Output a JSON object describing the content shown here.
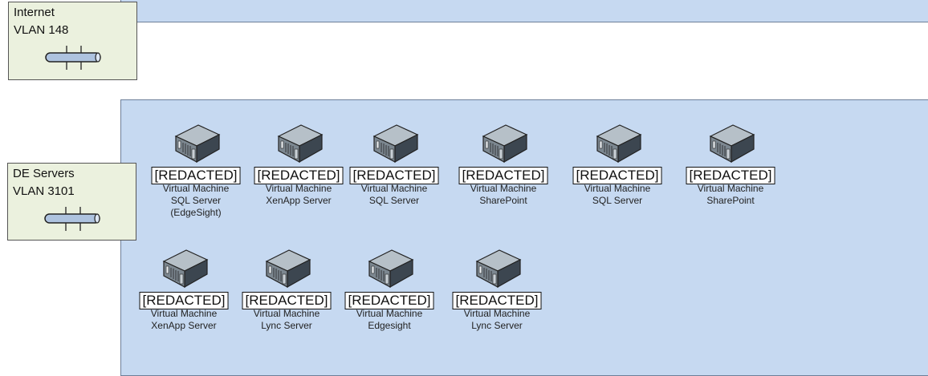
{
  "vlans": [
    {
      "name": "Internet",
      "vlan": "VLAN 148"
    },
    {
      "name": "DE Servers",
      "vlan": "VLAN 3101"
    }
  ],
  "servers_row1": [
    {
      "redacted": "[REDACTED]",
      "lines": [
        "Virtual Machine",
        "SQL Server",
        "(EdgeSight)"
      ]
    },
    {
      "redacted": "[REDACTED]",
      "lines": [
        "Virtual Machine",
        "XenApp Server"
      ]
    },
    {
      "redacted": "[REDACTED]",
      "lines": [
        "Virtual Machine",
        "SQL Server"
      ]
    },
    {
      "redacted": "[REDACTED]",
      "lines": [
        "Virtual Machine",
        "SharePoint"
      ]
    },
    {
      "redacted": "[REDACTED]",
      "lines": [
        "Virtual Machine",
        "SQL Server"
      ]
    },
    {
      "redacted": "[REDACTED]",
      "lines": [
        "Virtual Machine",
        "SharePoint"
      ]
    }
  ],
  "servers_row2": [
    {
      "redacted": "[REDACTED]",
      "lines": [
        "Virtual Machine",
        "XenApp Server"
      ]
    },
    {
      "redacted": "[REDACTED]",
      "lines": [
        "Virtual Machine",
        "Lync Server"
      ]
    },
    {
      "redacted": "[REDACTED]",
      "lines": [
        "Virtual Machine",
        "Edgesight"
      ]
    },
    {
      "redacted": "[REDACTED]",
      "lines": [
        "Virtual Machine",
        "Lync Server"
      ]
    }
  ]
}
